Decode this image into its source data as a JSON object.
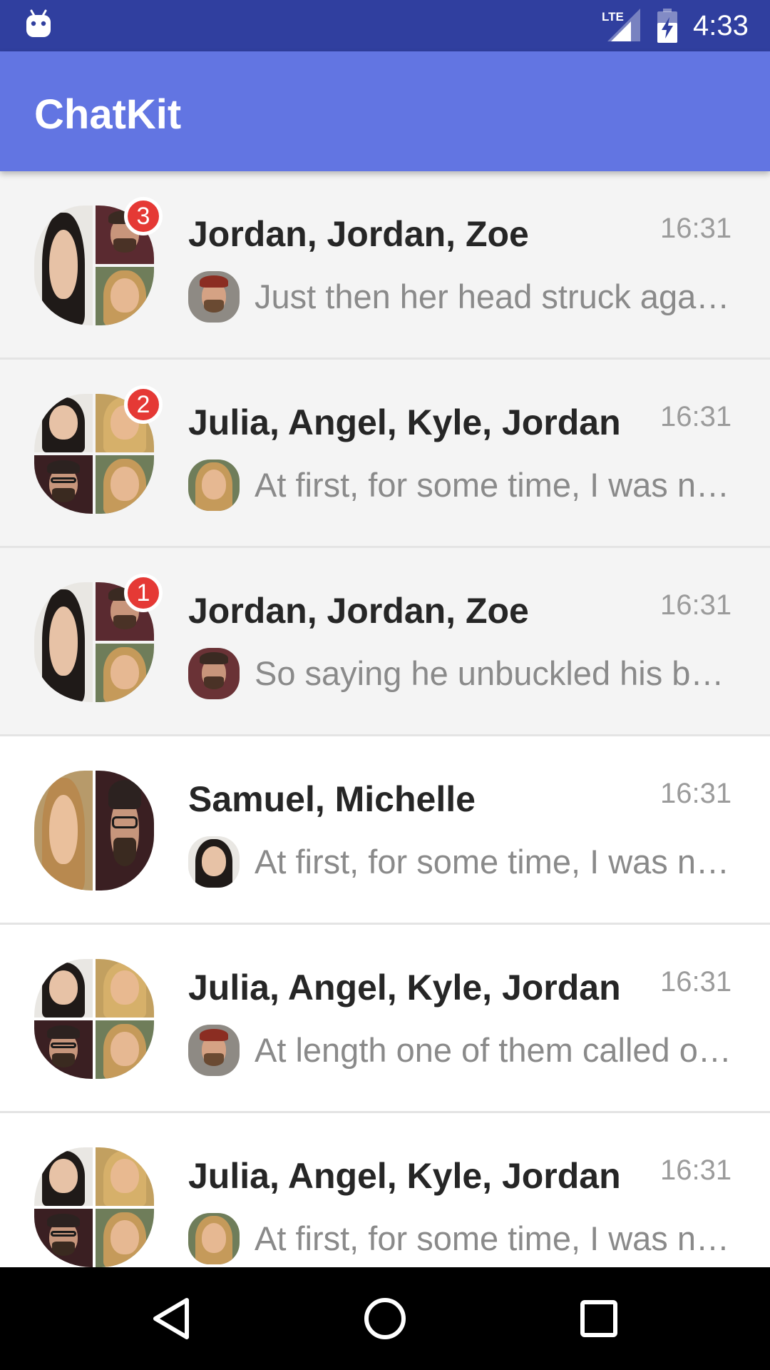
{
  "status_bar": {
    "time": "4:33",
    "network": "LTE",
    "icons": [
      "android-robot-icon",
      "lte-signal-icon",
      "battery-charging-icon"
    ]
  },
  "app_bar": {
    "title": "ChatKit"
  },
  "dialogs": [
    {
      "name": "Jordan, Jordan, Zoe",
      "time": "16:31",
      "message": "Just then her head struck against the roof of the hall",
      "unread_count": "3",
      "unread": true,
      "avatar_layout": "three",
      "mini_avatar": "samuel-beanie"
    },
    {
      "name": "Julia, Angel, Kyle, Jordan",
      "time": "16:31",
      "message": "At first, for some time, I was not able to answer him",
      "unread_count": "2",
      "unread": true,
      "avatar_layout": "four",
      "mini_avatar": "zoe"
    },
    {
      "name": "Jordan, Jordan, Zoe",
      "time": "16:31",
      "message": "So saying he unbuckled his baldric with the bugle",
      "unread_count": "1",
      "unread": true,
      "avatar_layout": "three",
      "mini_avatar": "jordan-beard"
    },
    {
      "name": "Samuel, Michelle",
      "time": "16:31",
      "message": "At first, for some time, I was not able to answer him",
      "unread_count": "",
      "unread": false,
      "avatar_layout": "two",
      "mini_avatar": "julia"
    },
    {
      "name": "Julia, Angel, Kyle, Jordan",
      "time": "16:31",
      "message": "At length one of them called out in a clear, polite, smooth voice",
      "unread_count": "",
      "unread": false,
      "avatar_layout": "four",
      "mini_avatar": "samuel-beanie"
    },
    {
      "name": "Julia, Angel, Kyle, Jordan",
      "time": "16:31",
      "message": "At first, for some time, I was not able to answer him",
      "unread_count": "",
      "unread": false,
      "avatar_layout": "four",
      "mini_avatar": "zoe"
    }
  ],
  "nav_bar": {
    "icons": [
      "back-icon",
      "home-icon",
      "recents-icon"
    ]
  },
  "colors": {
    "status_bar": "#303f9f",
    "app_bar": "#6275e2",
    "badge": "#e53935",
    "unread_bg": "#f4f4f4",
    "read_bg": "#ffffff",
    "name_text": "#262626",
    "message_text": "#8a8a8a",
    "time_text": "#9b9b9b"
  }
}
